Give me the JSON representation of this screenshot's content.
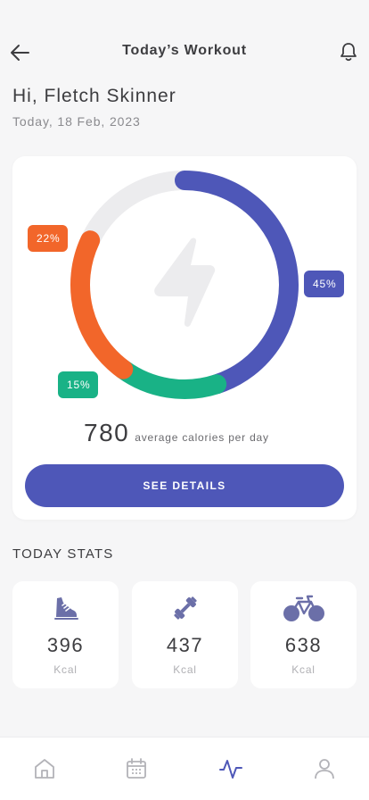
{
  "header": {
    "title": "Today’s Workout"
  },
  "user": {
    "greeting": "Hi, Fletch Skinner",
    "date": "Today, 18 Feb, 2023"
  },
  "ring": {
    "segments": [
      {
        "name": "blue",
        "percent": 45,
        "label": "45%",
        "color": "#4e57b8"
      },
      {
        "name": "green",
        "percent": 15,
        "label": "15%",
        "color": "#19b286"
      },
      {
        "name": "orange",
        "percent": 22,
        "label": "22%",
        "color": "#f2662a"
      }
    ],
    "track_color": "#ececee",
    "center_icon": "lightning-icon"
  },
  "calories": {
    "value": "780",
    "label": "average calories per day"
  },
  "details_button": "SEE DETAILS",
  "stats": {
    "title": "TODAY STATS",
    "items": [
      {
        "icon": "shoe-icon",
        "value": "396",
        "unit": "Kcal"
      },
      {
        "icon": "dumbbell-icon",
        "value": "437",
        "unit": "Kcal"
      },
      {
        "icon": "bicycle-icon",
        "value": "638",
        "unit": "Kcal"
      }
    ]
  },
  "nav": {
    "items": [
      "home-icon",
      "calendar-icon",
      "activity-icon",
      "profile-icon"
    ],
    "active": "activity-icon"
  },
  "colors": {
    "accent": "#4e57b8",
    "orange": "#f2662a",
    "green": "#19b286",
    "icon": "#6b6fa8"
  }
}
